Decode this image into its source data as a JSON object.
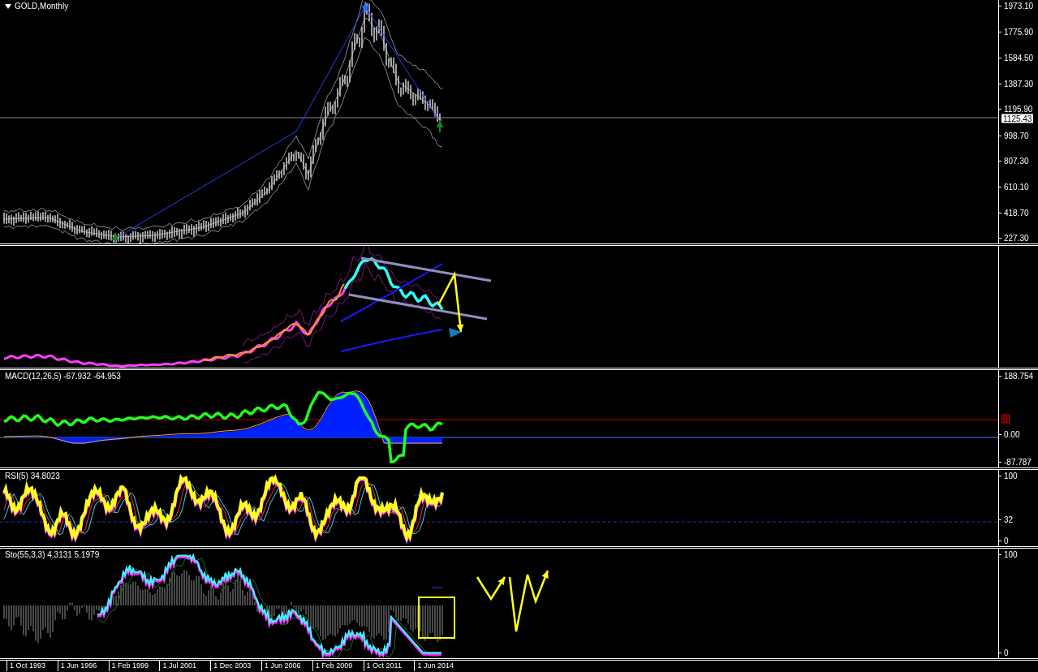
{
  "chart": {
    "title": "GOLD,Monthly"
  },
  "panes": [
    {
      "kind": "price",
      "axis_labels": [
        "1973.10",
        "1775.90",
        "1584.50",
        "1387.30",
        "1195.90",
        "998.70",
        "807.30",
        "610.10",
        "418.70",
        "227.30"
      ],
      "current_price": "1125.43"
    },
    {
      "kind": "overlay"
    },
    {
      "kind": "macd",
      "label": "MACD(12,26,5) -67.932 -64.953",
      "axis_labels": [
        "188.754",
        "0.00",
        "-87.787"
      ],
      "signal_label": "0"
    },
    {
      "kind": "rsi",
      "label": "RSI(5) 34.8023",
      "axis_labels": [
        "100",
        "32",
        "0"
      ]
    },
    {
      "kind": "stochastic",
      "label": "Sto(55,3,3) 4.3131 5.1979",
      "axis_labels": [
        "100",
        "0"
      ]
    }
  ],
  "time_axis": [
    "1 Oct 1993",
    "1 Jun 1996",
    "1 Feb 1999",
    "1 Jul 2001",
    "1 Dec 2003",
    "1 Jun 2006",
    "1 Feb 2009",
    "1 Oct 2011",
    "1 Jun 2014"
  ]
}
